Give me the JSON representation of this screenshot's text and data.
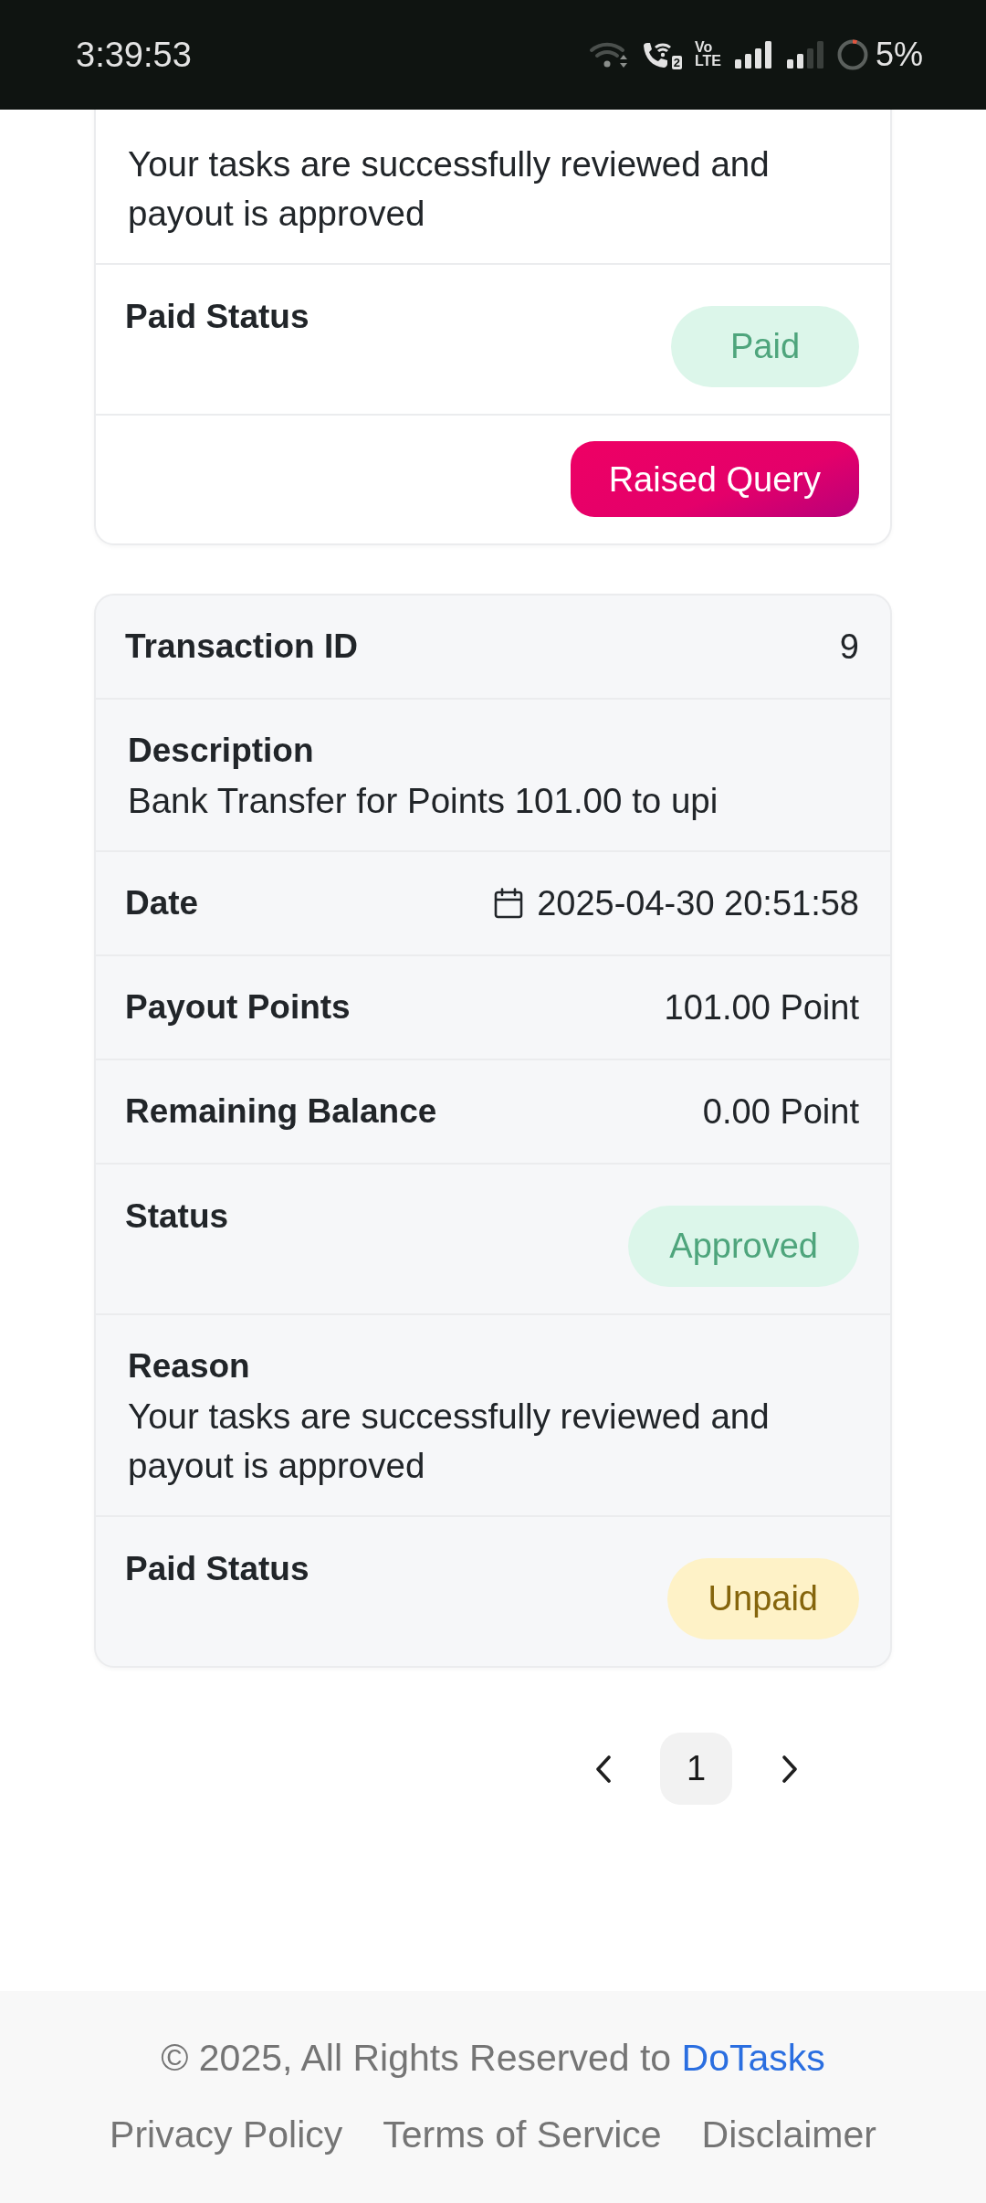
{
  "status_bar": {
    "time": "3:39:53",
    "sim_number": "2",
    "volte_top": "Vo",
    "volte_bottom": "LTE",
    "battery": "5%"
  },
  "transactions": [
    {
      "color": "#ffffff",
      "rows": [
        {
          "kind": "text",
          "value": "Your tasks are successfully reviewed and payout is approved"
        },
        {
          "kind": "badge",
          "label": "Paid Status",
          "badge": {
            "text": "Paid",
            "kind": "success"
          }
        },
        {
          "kind": "action",
          "button": "Raised Query"
        }
      ]
    },
    {
      "color": "#f6f7f9",
      "rows": [
        {
          "kind": "pair",
          "label": "Transaction ID",
          "value": "9"
        },
        {
          "kind": "text",
          "label": "Description",
          "value": "Bank Transfer for Points 101.00 to upi"
        },
        {
          "kind": "date",
          "label": "Date",
          "value": "2025-04-30 20:51:58"
        },
        {
          "kind": "pair",
          "label": "Payout Points",
          "value": "101.00 Point"
        },
        {
          "kind": "pair",
          "label": "Remaining Balance",
          "value": "0.00 Point"
        },
        {
          "kind": "badge",
          "label": "Status",
          "badge": {
            "text": "Approved",
            "kind": "success"
          }
        },
        {
          "kind": "text",
          "label": "Reason",
          "value": "Your tasks are successfully reviewed and payout is approved"
        },
        {
          "kind": "badge",
          "label": "Paid Status",
          "badge": {
            "text": "Unpaid",
            "kind": "warning"
          }
        }
      ]
    }
  ],
  "pagination": {
    "pages": [
      {
        "label": "1",
        "selected": true
      }
    ]
  },
  "footer": {
    "copyright": "© 2025, All Rights Reserved to",
    "brand": "DoTasks",
    "links": [
      "Privacy Policy",
      "Terms of Service",
      "Disclaimer"
    ]
  }
}
